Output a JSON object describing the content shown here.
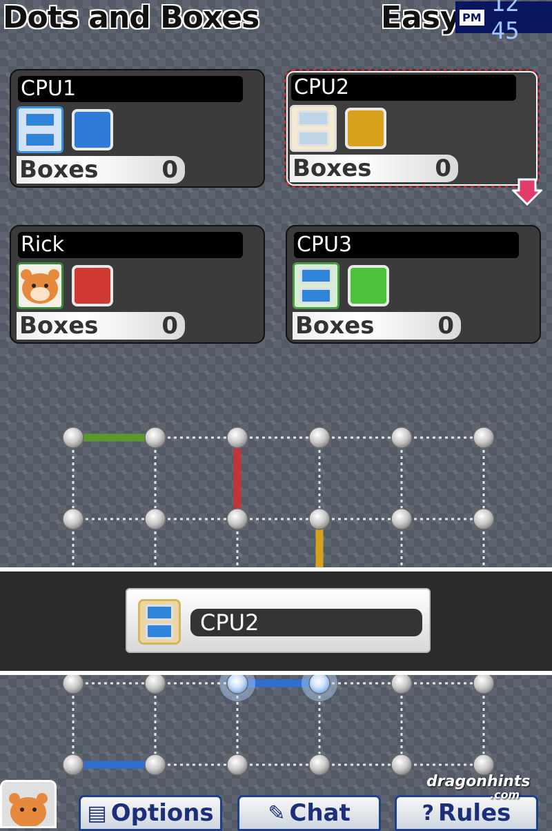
{
  "header": {
    "title": "Dots and Boxes",
    "difficulty": "Easy",
    "clock": {
      "ampm": "PM",
      "time": "12 45"
    }
  },
  "players": [
    {
      "name": "CPU1",
      "avatar": "ds-icon",
      "color": "#2f7bd8",
      "boxes_label": "Boxes",
      "boxes": "0",
      "active": false
    },
    {
      "name": "CPU2",
      "avatar": "ds-icon",
      "color": "#d6a21e",
      "boxes_label": "Boxes",
      "boxes": "0",
      "active": true
    },
    {
      "name": "Rick",
      "avatar": "hamster-icon",
      "color": "#d03a34",
      "boxes_label": "Boxes",
      "boxes": "0",
      "active": false
    },
    {
      "name": "CPU3",
      "avatar": "ds-icon",
      "color": "#4cc23b",
      "boxes_label": "Boxes",
      "boxes": "0",
      "active": false
    }
  ],
  "turn": {
    "name": "CPU2",
    "avatar": "ds-icon"
  },
  "board": {
    "cols": 6,
    "drawn_lines": [
      {
        "from": [
          0,
          0
        ],
        "to": [
          1,
          0
        ],
        "color": "#5a9a2a"
      },
      {
        "from": [
          2,
          0
        ],
        "to": [
          2,
          1
        ],
        "color": "#c43434"
      },
      {
        "from": [
          3,
          1
        ],
        "to": [
          3,
          2
        ],
        "color": "#d6a21e"
      },
      {
        "from": [
          2,
          3
        ],
        "to": [
          3,
          3
        ],
        "color": "#2f6fd0"
      },
      {
        "from": [
          0,
          4
        ],
        "to": [
          1,
          4
        ],
        "color": "#2f6fd0"
      }
    ],
    "highlighted_dots": [
      [
        2,
        3
      ],
      [
        3,
        3
      ]
    ]
  },
  "nav": {
    "options": {
      "label": "Options",
      "icon": "notepad-icon"
    },
    "chat": {
      "label": "Chat",
      "icon": "pencil-icon"
    },
    "rules": {
      "label": "Rules",
      "icon": "question-icon"
    }
  },
  "watermark": {
    "text": "dragonhints",
    "sub": ".com"
  }
}
